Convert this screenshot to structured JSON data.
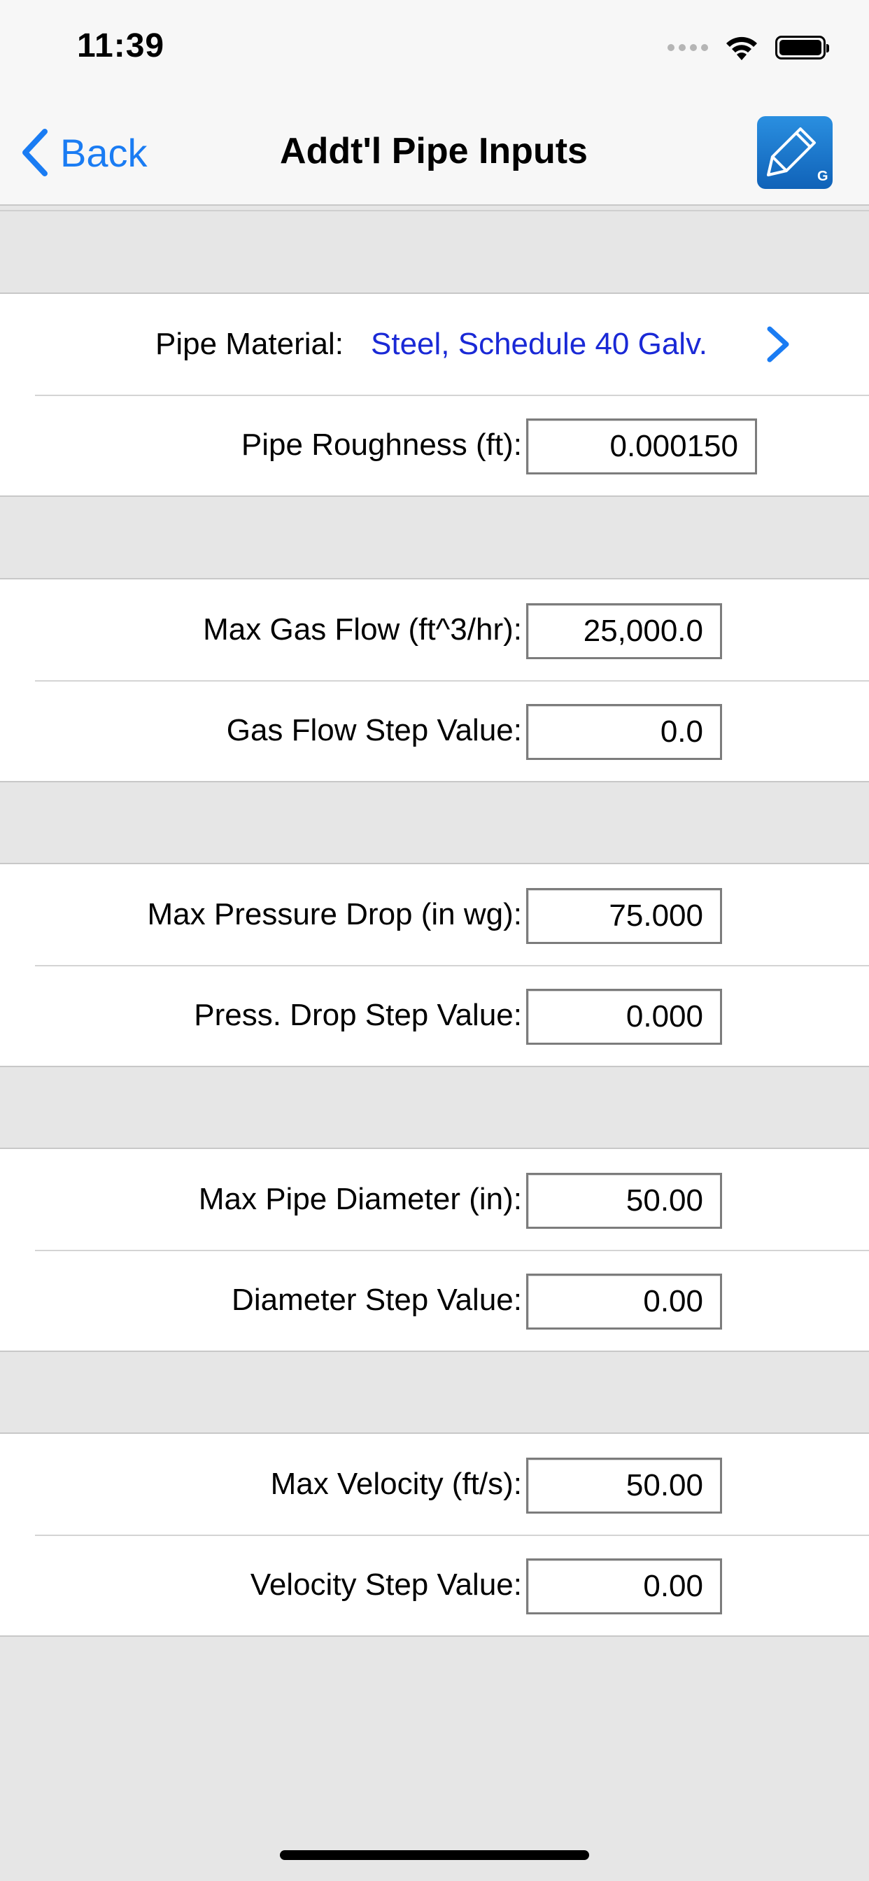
{
  "status_bar": {
    "time": "11:39"
  },
  "nav": {
    "back_label": "Back",
    "title": "Addt'l Pipe Inputs",
    "app_icon_letter": "G"
  },
  "colors": {
    "accent": "#1a7cf3",
    "link_value": "#1a29d6",
    "background": "#e6e6e6"
  },
  "material": {
    "label": "Pipe Material:",
    "value": "Steel, Schedule 40 Galv."
  },
  "roughness": {
    "label": "Pipe Roughness (ft):",
    "value": "0.000150"
  },
  "gas_flow": {
    "max_label": "Max Gas Flow (ft^3/hr):",
    "max_value": "25,000.0",
    "step_label": "Gas Flow Step Value:",
    "step_value": "0.0"
  },
  "pressure": {
    "max_label": "Max Pressure Drop (in wg):",
    "max_value": "75.000",
    "step_label": "Press. Drop Step Value:",
    "step_value": "0.000"
  },
  "diameter": {
    "max_label": "Max Pipe Diameter (in):",
    "max_value": "50.00",
    "step_label": "Diameter Step Value:",
    "step_value": "0.00"
  },
  "velocity": {
    "max_label": "Max Velocity (ft/s):",
    "max_value": "50.00",
    "step_label": "Velocity Step Value:",
    "step_value": "0.00"
  }
}
